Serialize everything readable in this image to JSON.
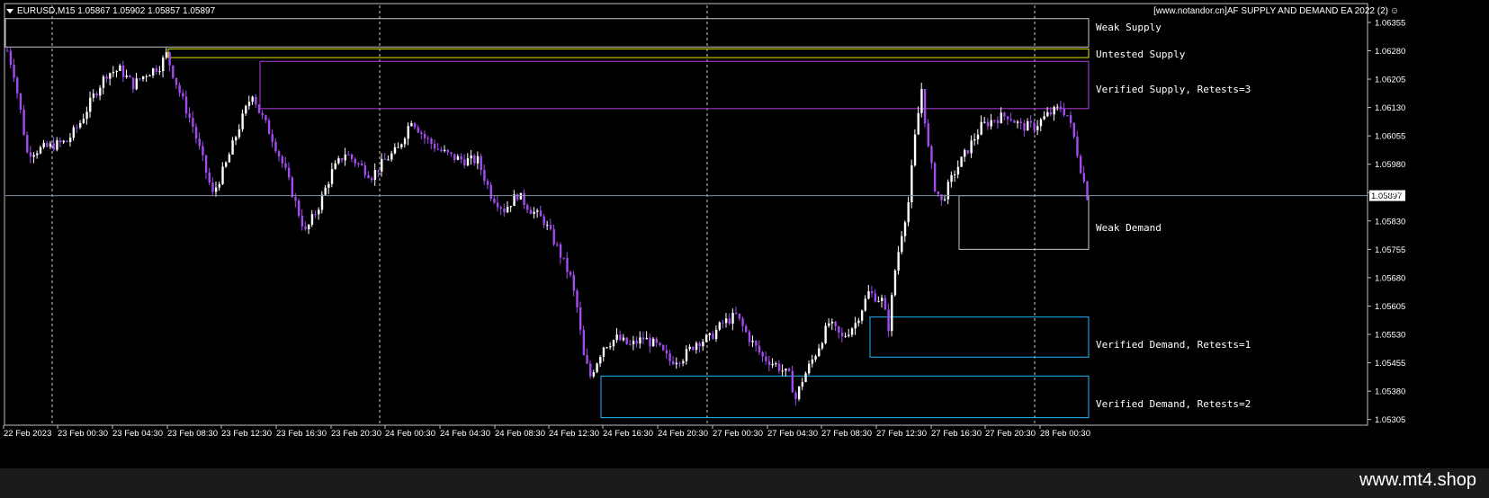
{
  "header": {
    "symbol_info": "EURUSD,M15  1.05867 1.05902 1.05857 1.05897",
    "ea_title": "[www.notandor.cn]AF SUPPLY AND DEMAND EA 2022 (2)",
    "smiley": "☺"
  },
  "watermark": "www.mt4.shop",
  "colors": {
    "background": "#000000",
    "candle": "#a24cf0",
    "candle_up": "#ffffff",
    "gridline": "#c8c8c8",
    "weak_supply": "#c8c8c8",
    "untested_supply": "#e8e800",
    "verified_supply": "#b040e0",
    "weak_demand": "#c8c8c8",
    "verified_demand": "#1fb6ff",
    "price_line": "#7f8fa6"
  },
  "zones": [
    {
      "label": "Weak Supply",
      "type": "weak_supply",
      "top": 1.06365,
      "bottom": 1.0629
    },
    {
      "label": "Untested Supply",
      "type": "untested_supply",
      "top": 1.06285,
      "bottom": 1.06262
    },
    {
      "label": "Verified Supply, Retests=3",
      "type": "verified_supply",
      "top": 1.06252,
      "bottom": 1.06127
    },
    {
      "label": "Weak Demand",
      "type": "weak_demand",
      "top": 1.05897,
      "bottom": 1.05755
    },
    {
      "label": "Verified Demand, Retests=1",
      "type": "verified_demand",
      "top": 1.05576,
      "bottom": 1.0547
    },
    {
      "label": "Verified Demand, Retests=2",
      "type": "verified_demand",
      "top": 1.0542,
      "bottom": 1.0531
    }
  ],
  "chart_data": {
    "type": "candlestick",
    "symbol": "EURUSD",
    "timeframe": "M15",
    "current_price": 1.05897,
    "current_price_label": "1.05897",
    "ylim": [
      1.0529,
      1.064
    ],
    "y_ticks": [
      1.06355,
      1.0628,
      1.06205,
      1.0613,
      1.06055,
      1.0598,
      1.05905,
      1.0583,
      1.05755,
      1.0568,
      1.05605,
      1.0553,
      1.05455,
      1.0538,
      1.05305
    ],
    "y_tick_labels": [
      "1.06355",
      "1.06280",
      "1.06205",
      "1.06130",
      "1.06055",
      "1.05980",
      "1.05905",
      "1.05830",
      "1.05755",
      "1.05680",
      "1.05605",
      "1.05530",
      "1.05455",
      "1.05380",
      "1.05305"
    ],
    "x_tick_labels": [
      "22 Feb 2023",
      "23 Feb 00:30",
      "23 Feb 04:30",
      "23 Feb 08:30",
      "23 Feb 12:30",
      "23 Feb 16:30",
      "23 Feb 20:30",
      "24 Feb 00:30",
      "24 Feb 04:30",
      "24 Feb 08:30",
      "24 Feb 12:30",
      "24 Feb 16:30",
      "24 Feb 20:30",
      "27 Feb 00:30",
      "27 Feb 04:30",
      "27 Feb 08:30",
      "27 Feb 12:30",
      "27 Feb 16:30",
      "27 Feb 20:30",
      "28 Feb 00:30"
    ],
    "day_separators": [
      "23 Feb 00:30",
      "24 Feb 00:30",
      "27 Feb 00:30",
      "28 Feb 00:30"
    ],
    "close_path": [
      [
        0,
        1.0628
      ],
      [
        2,
        1.0622
      ],
      [
        4,
        1.0612
      ],
      [
        6,
        1.0601
      ],
      [
        10,
        1.0602
      ],
      [
        14,
        1.0603
      ],
      [
        18,
        1.0604
      ],
      [
        22,
        1.0609
      ],
      [
        26,
        1.0616
      ],
      [
        30,
        1.0622
      ],
      [
        34,
        1.0623
      ],
      [
        38,
        1.0619
      ],
      [
        42,
        1.0622
      ],
      [
        46,
        1.0624
      ],
      [
        48,
        1.0627
      ],
      [
        52,
        1.0617
      ],
      [
        56,
        1.0608
      ],
      [
        60,
        1.0596
      ],
      [
        62,
        1.059
      ],
      [
        66,
        1.0598
      ],
      [
        70,
        1.0608
      ],
      [
        74,
        1.0617
      ],
      [
        76,
        1.0612
      ],
      [
        80,
        1.0605
      ],
      [
        84,
        1.0596
      ],
      [
        88,
        1.0585
      ],
      [
        90,
        1.058
      ],
      [
        94,
        1.0587
      ],
      [
        98,
        1.0596
      ],
      [
        102,
        1.0601
      ],
      [
        106,
        1.0598
      ],
      [
        110,
        1.0595
      ],
      [
        114,
        1.0599
      ],
      [
        118,
        1.0602
      ],
      [
        122,
        1.061
      ],
      [
        126,
        1.0605
      ],
      [
        130,
        1.0602
      ],
      [
        134,
        1.06
      ],
      [
        138,
        1.0599
      ],
      [
        142,
        1.0599
      ],
      [
        146,
        1.059
      ],
      [
        150,
        1.0586
      ],
      [
        154,
        1.059
      ],
      [
        158,
        1.0586
      ],
      [
        162,
        1.0583
      ],
      [
        166,
        1.0576
      ],
      [
        170,
        1.0568
      ],
      [
        172,
        1.056
      ],
      [
        174,
        1.0547
      ],
      [
        176,
        1.0542
      ],
      [
        180,
        1.055
      ],
      [
        184,
        1.0552
      ],
      [
        188,
        1.055
      ],
      [
        192,
        1.0552
      ],
      [
        196,
        1.055
      ],
      [
        200,
        1.0546
      ],
      [
        204,
        1.0547
      ],
      [
        208,
        1.0551
      ],
      [
        212,
        1.0552
      ],
      [
        216,
        1.0556
      ],
      [
        220,
        1.0558
      ],
      [
        224,
        1.0552
      ],
      [
        228,
        1.0547
      ],
      [
        232,
        1.0545
      ],
      [
        236,
        1.0542
      ],
      [
        238,
        1.0536
      ],
      [
        240,
        1.0541
      ],
      [
        244,
        1.0548
      ],
      [
        248,
        1.0556
      ],
      [
        252,
        1.0552
      ],
      [
        256,
        1.0556
      ],
      [
        260,
        1.0564
      ],
      [
        264,
        1.0562
      ],
      [
        266,
        1.0555
      ],
      [
        268,
        1.057
      ],
      [
        270,
        1.058
      ],
      [
        272,
        1.0588
      ],
      [
        274,
        1.0605
      ],
      [
        276,
        1.0618
      ],
      [
        278,
        1.0602
      ],
      [
        280,
        1.0592
      ],
      [
        282,
        1.0588
      ],
      [
        286,
        1.0596
      ],
      [
        290,
        1.0602
      ],
      [
        294,
        1.0608
      ],
      [
        298,
        1.061
      ],
      [
        302,
        1.0611
      ],
      [
        306,
        1.0608
      ],
      [
        310,
        1.0608
      ],
      [
        314,
        1.0611
      ],
      [
        318,
        1.0613
      ],
      [
        320,
        1.0611
      ],
      [
        322,
        1.0605
      ],
      [
        324,
        1.0597
      ],
      [
        326,
        1.05897
      ]
    ],
    "bar_count": 327
  }
}
